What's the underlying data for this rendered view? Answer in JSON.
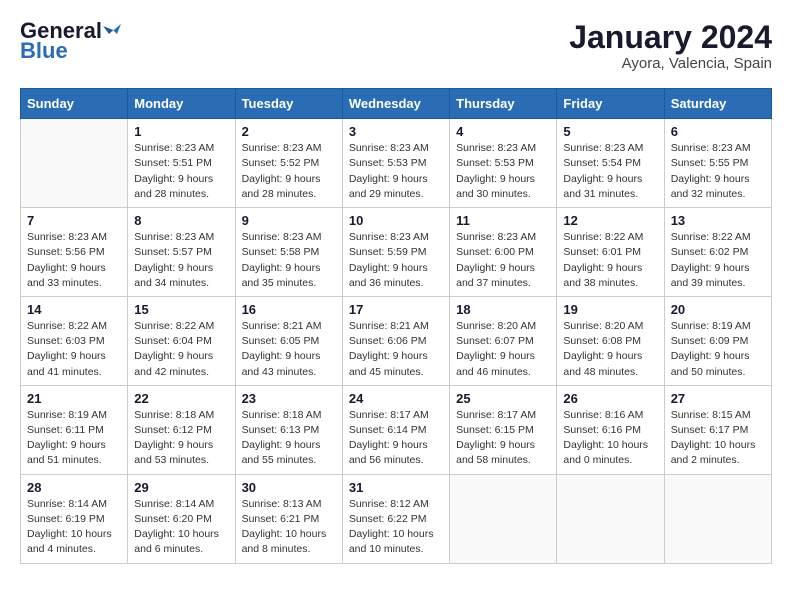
{
  "header": {
    "logo_general": "General",
    "logo_blue": "Blue",
    "month_year": "January 2024",
    "location": "Ayora, Valencia, Spain"
  },
  "days_of_week": [
    "Sunday",
    "Monday",
    "Tuesday",
    "Wednesday",
    "Thursday",
    "Friday",
    "Saturday"
  ],
  "weeks": [
    [
      {
        "day": "",
        "text": ""
      },
      {
        "day": "1",
        "text": "Sunrise: 8:23 AM\nSunset: 5:51 PM\nDaylight: 9 hours\nand 28 minutes."
      },
      {
        "day": "2",
        "text": "Sunrise: 8:23 AM\nSunset: 5:52 PM\nDaylight: 9 hours\nand 28 minutes."
      },
      {
        "day": "3",
        "text": "Sunrise: 8:23 AM\nSunset: 5:53 PM\nDaylight: 9 hours\nand 29 minutes."
      },
      {
        "day": "4",
        "text": "Sunrise: 8:23 AM\nSunset: 5:53 PM\nDaylight: 9 hours\nand 30 minutes."
      },
      {
        "day": "5",
        "text": "Sunrise: 8:23 AM\nSunset: 5:54 PM\nDaylight: 9 hours\nand 31 minutes."
      },
      {
        "day": "6",
        "text": "Sunrise: 8:23 AM\nSunset: 5:55 PM\nDaylight: 9 hours\nand 32 minutes."
      }
    ],
    [
      {
        "day": "7",
        "text": "Sunrise: 8:23 AM\nSunset: 5:56 PM\nDaylight: 9 hours\nand 33 minutes."
      },
      {
        "day": "8",
        "text": "Sunrise: 8:23 AM\nSunset: 5:57 PM\nDaylight: 9 hours\nand 34 minutes."
      },
      {
        "day": "9",
        "text": "Sunrise: 8:23 AM\nSunset: 5:58 PM\nDaylight: 9 hours\nand 35 minutes."
      },
      {
        "day": "10",
        "text": "Sunrise: 8:23 AM\nSunset: 5:59 PM\nDaylight: 9 hours\nand 36 minutes."
      },
      {
        "day": "11",
        "text": "Sunrise: 8:23 AM\nSunset: 6:00 PM\nDaylight: 9 hours\nand 37 minutes."
      },
      {
        "day": "12",
        "text": "Sunrise: 8:22 AM\nSunset: 6:01 PM\nDaylight: 9 hours\nand 38 minutes."
      },
      {
        "day": "13",
        "text": "Sunrise: 8:22 AM\nSunset: 6:02 PM\nDaylight: 9 hours\nand 39 minutes."
      }
    ],
    [
      {
        "day": "14",
        "text": "Sunrise: 8:22 AM\nSunset: 6:03 PM\nDaylight: 9 hours\nand 41 minutes."
      },
      {
        "day": "15",
        "text": "Sunrise: 8:22 AM\nSunset: 6:04 PM\nDaylight: 9 hours\nand 42 minutes."
      },
      {
        "day": "16",
        "text": "Sunrise: 8:21 AM\nSunset: 6:05 PM\nDaylight: 9 hours\nand 43 minutes."
      },
      {
        "day": "17",
        "text": "Sunrise: 8:21 AM\nSunset: 6:06 PM\nDaylight: 9 hours\nand 45 minutes."
      },
      {
        "day": "18",
        "text": "Sunrise: 8:20 AM\nSunset: 6:07 PM\nDaylight: 9 hours\nand 46 minutes."
      },
      {
        "day": "19",
        "text": "Sunrise: 8:20 AM\nSunset: 6:08 PM\nDaylight: 9 hours\nand 48 minutes."
      },
      {
        "day": "20",
        "text": "Sunrise: 8:19 AM\nSunset: 6:09 PM\nDaylight: 9 hours\nand 50 minutes."
      }
    ],
    [
      {
        "day": "21",
        "text": "Sunrise: 8:19 AM\nSunset: 6:11 PM\nDaylight: 9 hours\nand 51 minutes."
      },
      {
        "day": "22",
        "text": "Sunrise: 8:18 AM\nSunset: 6:12 PM\nDaylight: 9 hours\nand 53 minutes."
      },
      {
        "day": "23",
        "text": "Sunrise: 8:18 AM\nSunset: 6:13 PM\nDaylight: 9 hours\nand 55 minutes."
      },
      {
        "day": "24",
        "text": "Sunrise: 8:17 AM\nSunset: 6:14 PM\nDaylight: 9 hours\nand 56 minutes."
      },
      {
        "day": "25",
        "text": "Sunrise: 8:17 AM\nSunset: 6:15 PM\nDaylight: 9 hours\nand 58 minutes."
      },
      {
        "day": "26",
        "text": "Sunrise: 8:16 AM\nSunset: 6:16 PM\nDaylight: 10 hours\nand 0 minutes."
      },
      {
        "day": "27",
        "text": "Sunrise: 8:15 AM\nSunset: 6:17 PM\nDaylight: 10 hours\nand 2 minutes."
      }
    ],
    [
      {
        "day": "28",
        "text": "Sunrise: 8:14 AM\nSunset: 6:19 PM\nDaylight: 10 hours\nand 4 minutes."
      },
      {
        "day": "29",
        "text": "Sunrise: 8:14 AM\nSunset: 6:20 PM\nDaylight: 10 hours\nand 6 minutes."
      },
      {
        "day": "30",
        "text": "Sunrise: 8:13 AM\nSunset: 6:21 PM\nDaylight: 10 hours\nand 8 minutes."
      },
      {
        "day": "31",
        "text": "Sunrise: 8:12 AM\nSunset: 6:22 PM\nDaylight: 10 hours\nand 10 minutes."
      },
      {
        "day": "",
        "text": ""
      },
      {
        "day": "",
        "text": ""
      },
      {
        "day": "",
        "text": ""
      }
    ]
  ]
}
